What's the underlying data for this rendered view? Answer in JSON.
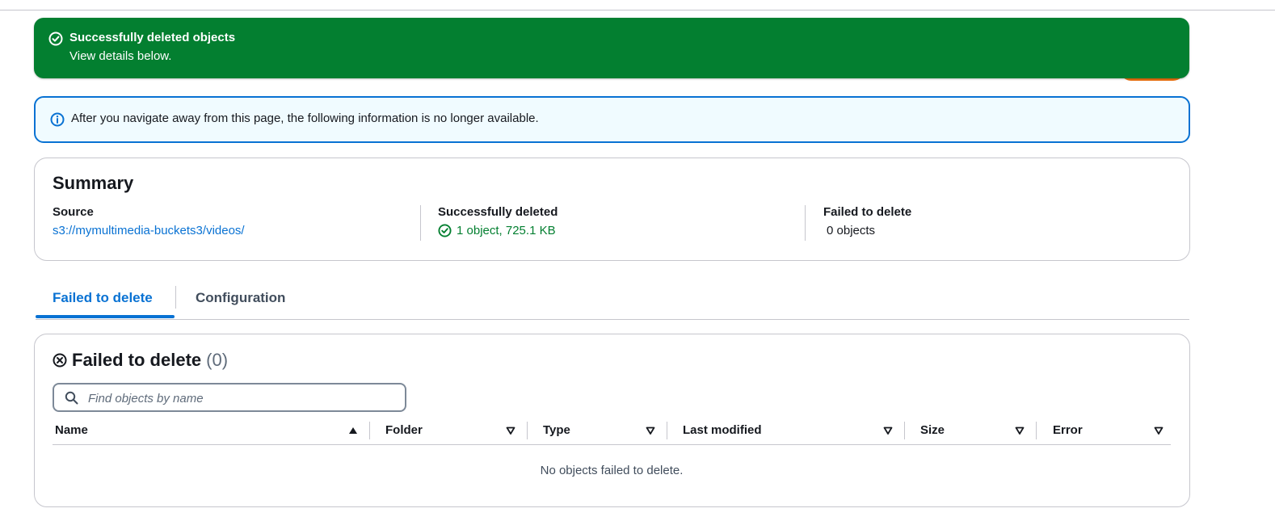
{
  "flash": {
    "title": "Successfully deleted objects",
    "message": "View details below.",
    "icon": "check-circle-icon",
    "color": "#037f30"
  },
  "info": {
    "message": "After you navigate away from this page, the following information is no longer available.",
    "icon": "info-icon"
  },
  "summary": {
    "title": "Summary",
    "source_label": "Source",
    "source_value": "s3://mymultimedia-buckets3/videos/",
    "deleted_label": "Successfully deleted",
    "deleted_value": "1 object, 725.1 KB",
    "failed_label": "Failed to delete",
    "failed_value": "0 objects"
  },
  "tabs": [
    {
      "label": "Failed to delete",
      "active": true
    },
    {
      "label": "Configuration",
      "active": false
    }
  ],
  "failed_panel": {
    "title": "Failed to delete",
    "count": "(0)",
    "search_placeholder": "Find objects by name",
    "columns": [
      "Name",
      "Folder",
      "Type",
      "Last modified",
      "Size",
      "Error"
    ],
    "empty_text": "No objects failed to delete."
  },
  "colors": {
    "accent": "#0972d3",
    "success": "#037f30",
    "info_bg": "#f0fbff"
  }
}
